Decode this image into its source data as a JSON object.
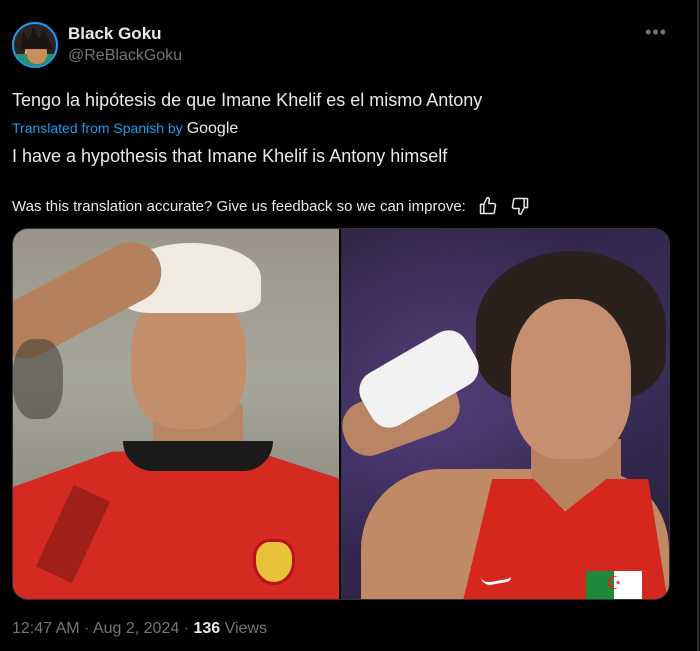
{
  "author": {
    "name": "Black Goku",
    "handle": "@ReBlackGoku"
  },
  "more_label": "•••",
  "tweet": {
    "text": "Tengo la hipótesis de que Imane Khelif es el mismo Antony",
    "translated_from": "Translated from Spanish by",
    "translator": "Google",
    "translation": "I have a hypothesis that Imane Khelif is Antony himself"
  },
  "feedback": {
    "prompt": "Was this translation accurate? Give us feedback so we can improve:",
    "up_icon": "thumbs-up-icon",
    "down_icon": "thumbs-down-icon"
  },
  "meta": {
    "time": "12:47 AM",
    "sep1": " · ",
    "date": "Aug 2, 2024",
    "sep2": " · ",
    "views_count": "136",
    "views_label": " Views"
  },
  "colors": {
    "background": "#000000",
    "link": "#1d9bf0",
    "secondary_text": "#71767b",
    "primary_text": "#e7e9ea"
  }
}
